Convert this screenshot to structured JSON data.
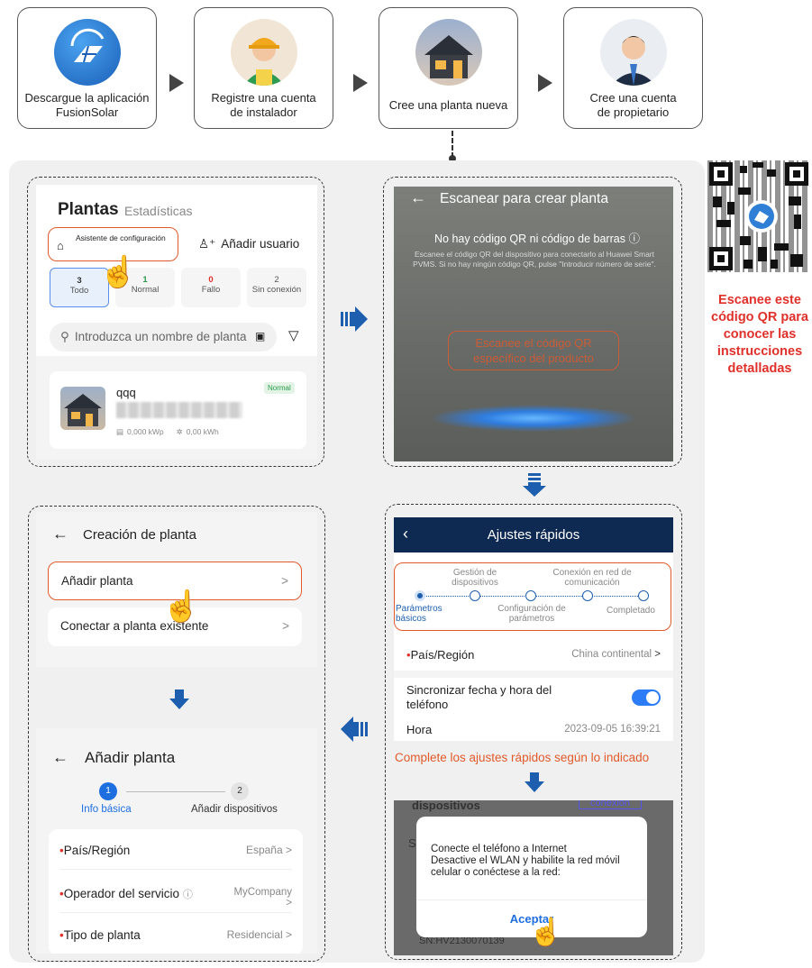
{
  "steps": [
    {
      "label": "Descargue la aplicación FusionSolar"
    },
    {
      "label": "Registre una cuenta de instalador"
    },
    {
      "label": "Cree una planta nueva"
    },
    {
      "label": "Cree una cuenta de propietario"
    }
  ],
  "side_note": "Escanee este código QR para conocer las instrucciones detalladas",
  "plants_screen": {
    "title": "Plantas",
    "tab_stats": "Estadísticas",
    "wizard": "Asistente de configuración",
    "add_user": "Añadir usuario",
    "filters": [
      {
        "count": "3",
        "label": "Todo"
      },
      {
        "count": "1",
        "label": "Normal"
      },
      {
        "count": "0",
        "label": "Fallo"
      },
      {
        "count": "2",
        "label": "Sin conexión"
      }
    ],
    "search_placeholder": "Introduzca un nombre de planta",
    "plant": {
      "name": "qqq",
      "status": "Normal",
      "kwp": "0,000 kWp",
      "kwh": "0,00 kWh"
    }
  },
  "scan_screen": {
    "title": "Escanear para crear planta",
    "no_code": "No hay código QR ni código de barras",
    "hint": "Escanee el código QR del dispositivo para conectarlo al Huawei Smart PVMS. Si no hay ningún código QR, pulse \"Introducir número de serie\".",
    "scan_label": "Escanee el código QR específico del producto"
  },
  "quick_settings": {
    "title": "Ajustes rápidos",
    "steps_top": [
      "Gestión de dispositivos",
      "Conexión en red de comunicación"
    ],
    "steps_bottom": [
      "Parámetros básicos",
      "Configuración de parámetros",
      "Completado"
    ],
    "country_label": "País/Región",
    "country_value": "China continental",
    "sync_label": "Sincronizar fecha y hora del teléfono",
    "time_label": "Hora",
    "time_value": "2023-09-05 16:39:21",
    "note": "Complete los ajustes rápidos según lo indicado"
  },
  "dialog_screen": {
    "bg_top": "dispositivos",
    "bg_btn": "conexión",
    "bg_side": "S",
    "bg_sn": "SN:HV2130070139",
    "message": "Conecte el teléfono a Internet\nDesactive el WLAN y habilite la red móvil celular o conéctese a la red:",
    "accept": "Aceptar"
  },
  "create_screen": {
    "title": "Creación de planta",
    "add_plant": "Añadir planta",
    "connect_existing": "Conectar a planta existente"
  },
  "add_screen": {
    "title": "Añadir planta",
    "steps": [
      {
        "num": "1",
        "label": "Info básica"
      },
      {
        "num": "2",
        "label": "Añadir dispositivos"
      }
    ],
    "rows": [
      {
        "label": "País/Región",
        "value": "España"
      },
      {
        "label": "Operador del servicio",
        "value": "MyCompany"
      },
      {
        "label": "Tipo de planta",
        "value": "Residencial"
      }
    ]
  },
  "colors": {
    "accent": "#e15a2b",
    "blue": "#1d5fae",
    "dark_header": "#0f2a52",
    "toggle": "#2b7cf6"
  }
}
